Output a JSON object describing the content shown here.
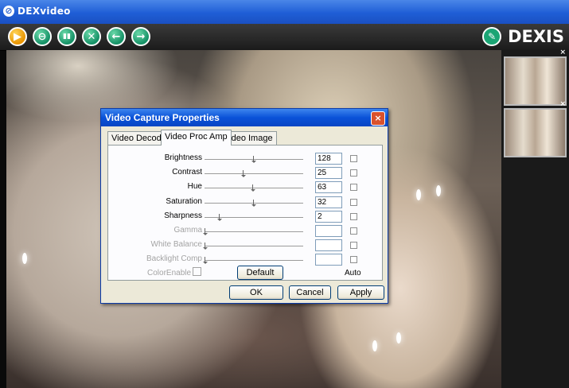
{
  "window": {
    "title": "DEXvideo"
  },
  "toolbar": {
    "buttons": [
      {
        "name": "play-button",
        "icon": "play-icon"
      },
      {
        "name": "open-button",
        "icon": "folder-icon"
      },
      {
        "name": "compare-button",
        "icon": "compare-icon"
      },
      {
        "name": "delete-button",
        "icon": "close-icon"
      },
      {
        "name": "back-button",
        "icon": "arrow-left-icon"
      },
      {
        "name": "forward-button",
        "icon": "arrow-right-icon"
      }
    ]
  },
  "brand": {
    "logo_text": "DEXIS",
    "accent": "#1aa574"
  },
  "thumbnails": [
    {
      "close": "×"
    },
    {
      "close": "×"
    }
  ],
  "dialog": {
    "title": "Video Capture Properties",
    "close": "×",
    "tabs": [
      "Video Decoder",
      "Video Proc Amp",
      "Video Image"
    ],
    "active_tab": "Video Proc Amp",
    "properties": [
      {
        "label": "Brightness",
        "value": "128",
        "slider": 0.5,
        "enabled": true
      },
      {
        "label": "Contrast",
        "value": "25",
        "slider": 0.39,
        "enabled": true
      },
      {
        "label": "Hue",
        "value": "63",
        "slider": 0.49,
        "enabled": true
      },
      {
        "label": "Saturation",
        "value": "32",
        "slider": 0.5,
        "enabled": true
      },
      {
        "label": "Sharpness",
        "value": "2",
        "slider": 0.15,
        "enabled": true
      },
      {
        "label": "Gamma",
        "value": "",
        "slider": 0.0,
        "enabled": false
      },
      {
        "label": "White Balance",
        "value": "",
        "slider": 0.0,
        "enabled": false
      },
      {
        "label": "Backlight Comp",
        "value": "",
        "slider": 0.0,
        "enabled": false
      }
    ],
    "color_enable_label": "ColorEnable",
    "default_label": "Default",
    "auto_label": "Auto",
    "ok_label": "OK",
    "cancel_label": "Cancel",
    "apply_label": "Apply"
  }
}
